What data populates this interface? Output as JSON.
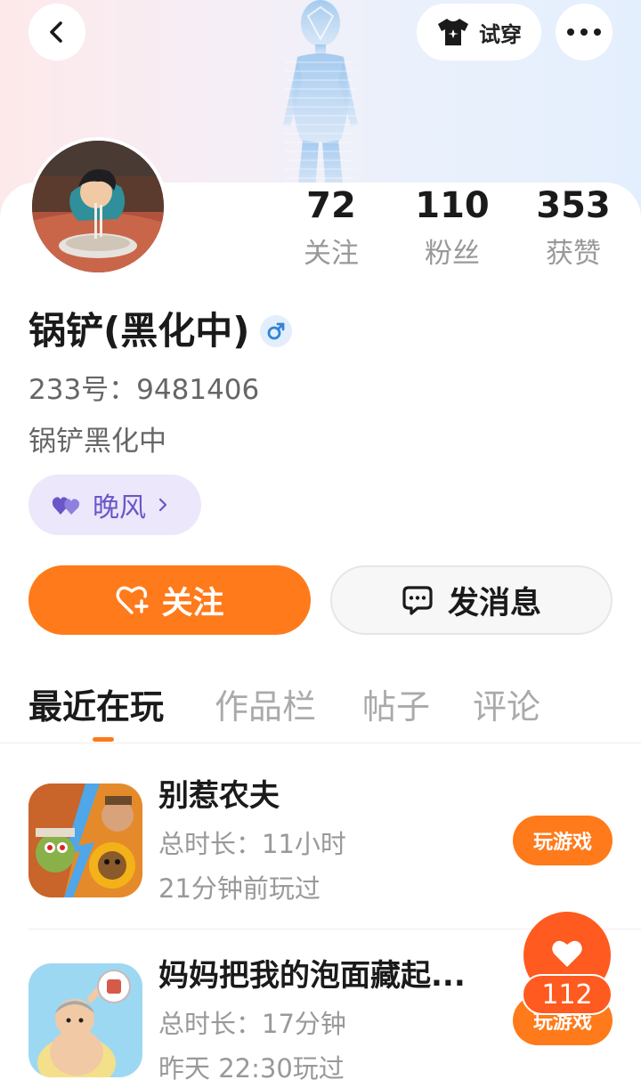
{
  "header": {
    "tryon_label": "试穿",
    "back_icon": "chevron-left-icon",
    "more_icon": "more-horizontal-icon",
    "tryon_icon": "tshirt-icon"
  },
  "profile": {
    "name": "锅铲(黑化中)",
    "gender": "♂",
    "uid_label": "233号：",
    "uid_value": "9481406",
    "bio": "锅铲黑化中",
    "fan_tag": "晚风"
  },
  "stats": [
    {
      "value": "72",
      "label": "关注"
    },
    {
      "value": "110",
      "label": "粉丝"
    },
    {
      "value": "353",
      "label": "获赞"
    }
  ],
  "actions": {
    "follow_label": "关注",
    "message_label": "发消息"
  },
  "tabs": [
    {
      "label": "最近在玩",
      "active": true
    },
    {
      "label": "作品栏",
      "active": false
    },
    {
      "label": "帖子",
      "active": false
    },
    {
      "label": "评论",
      "active": false
    }
  ],
  "games": [
    {
      "title": "别惹农夫",
      "duration": "总时长：11小时",
      "last_played": "21分钟前玩过",
      "button": "玩游戏"
    },
    {
      "title": "妈妈把我的泡面藏起...",
      "duration": "总时长：17分钟",
      "last_played": "昨天 22:30玩过",
      "button": "玩游戏"
    }
  ],
  "like_float": {
    "count": "112"
  },
  "colors": {
    "accent": "#ff7a1a",
    "like": "#ff5a1f",
    "tag_bg": "#ece7fb",
    "tag_text": "#6a56c8"
  }
}
